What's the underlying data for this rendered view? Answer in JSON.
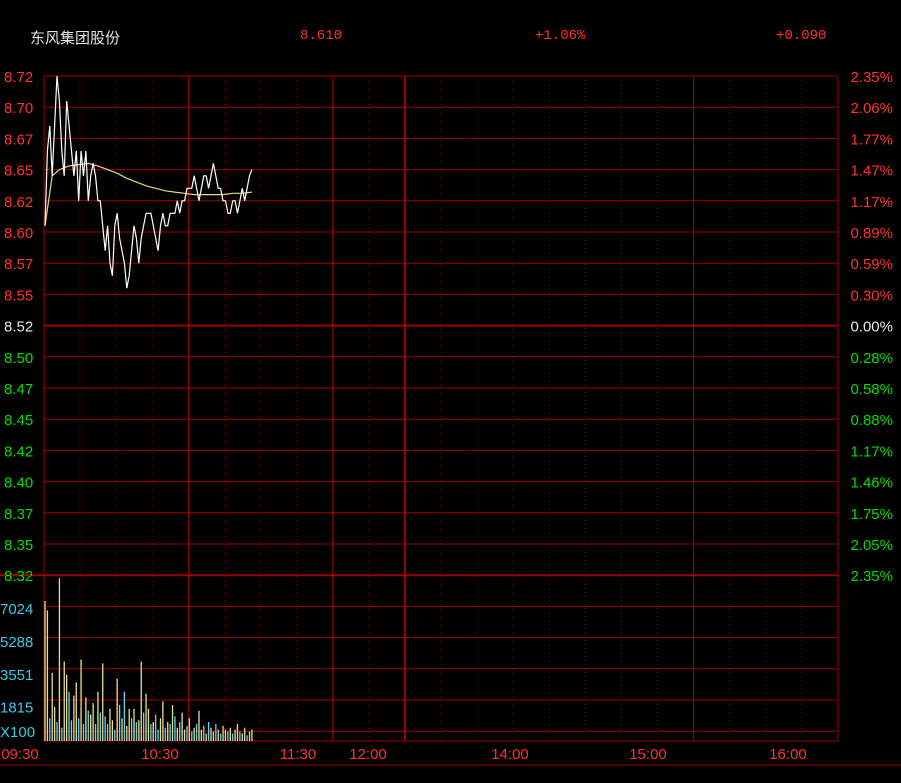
{
  "header": {
    "stock_name": "东风集团股份",
    "price": "8.610",
    "change_pct": "+1.06%",
    "change_abs": "+0.090"
  },
  "colors": {
    "up": "#ff3030",
    "down": "#00dd00",
    "flat": "#e8e8e8",
    "grid": "#a00000",
    "volume_label": "#38c8e8",
    "price_line": "#ffffff",
    "avg_line": "#e8d878",
    "volume_up": "#e8e090",
    "volume_down": "#60d8f0"
  },
  "chart_data": {
    "type": "line",
    "title": "",
    "price_axis": {
      "labels": [
        "8.72",
        "8.70",
        "8.67",
        "8.65",
        "8.62",
        "8.60",
        "8.57",
        "8.55",
        "8.52",
        "8.50",
        "8.47",
        "8.45",
        "8.42",
        "8.40",
        "8.37",
        "8.35",
        "8.32"
      ],
      "ylim": [
        8.32,
        8.72
      ],
      "prev_close": 8.52
    },
    "pct_axis": {
      "labels": [
        "2.35%",
        "2.06%",
        "1.77%",
        "1.47%",
        "1.17%",
        "0.89%",
        "0.59%",
        "0.30%",
        "0.00%",
        "0.28%",
        "0.58%",
        "0.88%",
        "1.17%",
        "1.46%",
        "1.75%",
        "2.05%",
        "2.35%"
      ]
    },
    "volume_axis": {
      "labels": [
        "7024",
        "5288",
        "3551",
        "1815",
        "X100"
      ],
      "ylim": [
        0,
        8760
      ]
    },
    "time_axis": {
      "labels": [
        "09:30",
        "10:30",
        "11:30",
        "12:00",
        "14:00",
        "15:00",
        "16:00"
      ],
      "total_minutes": 330
    },
    "series": [
      {
        "name": "",
        "minutes": [
          0,
          1,
          2,
          3,
          4,
          5,
          6,
          7,
          8,
          9,
          10,
          11,
          12,
          13,
          14,
          15,
          16,
          17,
          18,
          19,
          20,
          21,
          22,
          23,
          24,
          25,
          26,
          27,
          28,
          29,
          30,
          31,
          32,
          33,
          34,
          35,
          36,
          37,
          38,
          39,
          40,
          41,
          42,
          43,
          44,
          45,
          46,
          47,
          48,
          49,
          50,
          51,
          52,
          53,
          54,
          55,
          56,
          57,
          58,
          59,
          60,
          61,
          62,
          63,
          64,
          65,
          66,
          67,
          68,
          69,
          70,
          71,
          72,
          73,
          74,
          75,
          76,
          77,
          78,
          79,
          80,
          81,
          82,
          83,
          84,
          85,
          86
        ],
        "values": [
          8.6,
          8.66,
          8.68,
          8.64,
          8.68,
          8.72,
          8.7,
          8.66,
          8.64,
          8.7,
          8.68,
          8.66,
          8.64,
          8.66,
          8.62,
          8.66,
          8.64,
          8.66,
          8.62,
          8.64,
          8.65,
          8.64,
          8.62,
          8.62,
          8.6,
          8.58,
          8.6,
          8.57,
          8.56,
          8.6,
          8.61,
          8.59,
          8.58,
          8.57,
          8.55,
          8.56,
          8.58,
          8.6,
          8.59,
          8.57,
          8.59,
          8.6,
          8.61,
          8.61,
          8.61,
          8.6,
          8.59,
          8.58,
          8.6,
          8.61,
          8.6,
          8.6,
          8.61,
          8.61,
          8.61,
          8.62,
          8.61,
          8.62,
          8.62,
          8.63,
          8.63,
          8.63,
          8.64,
          8.63,
          8.62,
          8.63,
          8.64,
          8.64,
          8.63,
          8.64,
          8.65,
          8.64,
          8.63,
          8.63,
          8.62,
          8.62,
          8.61,
          8.61,
          8.62,
          8.62,
          8.61,
          8.62,
          8.63,
          8.62,
          8.63,
          8.64,
          8.645
        ]
      },
      {
        "name": "",
        "minutes": [
          0,
          3,
          6,
          10,
          14,
          18,
          22,
          26,
          30,
          34,
          38,
          42,
          46,
          50,
          54,
          58,
          62,
          66,
          70,
          74,
          78,
          82,
          86
        ],
        "values": [
          8.6,
          8.64,
          8.645,
          8.648,
          8.649,
          8.65,
          8.648,
          8.645,
          8.642,
          8.638,
          8.635,
          8.632,
          8.63,
          8.628,
          8.627,
          8.626,
          8.625,
          8.625,
          8.625,
          8.625,
          8.626,
          8.626,
          8.627
        ]
      }
    ],
    "volume": {
      "minutes": [
        0,
        1,
        2,
        3,
        4,
        5,
        6,
        7,
        8,
        9,
        10,
        11,
        12,
        13,
        14,
        15,
        16,
        17,
        18,
        19,
        20,
        21,
        22,
        23,
        24,
        25,
        26,
        27,
        28,
        29,
        30,
        31,
        32,
        33,
        34,
        35,
        36,
        37,
        38,
        39,
        40,
        41,
        42,
        43,
        44,
        45,
        46,
        47,
        48,
        49,
        50,
        51,
        52,
        53,
        54,
        55,
        56,
        57,
        58,
        59,
        60,
        61,
        62,
        63,
        64,
        65,
        66,
        67,
        68,
        69,
        70,
        71,
        72,
        73,
        74,
        75,
        76,
        77,
        78,
        79,
        80,
        81,
        82,
        83,
        84,
        85,
        86
      ],
      "values": [
        7400,
        6900,
        1200,
        3600,
        1800,
        1000,
        8600,
        700,
        4200,
        3500,
        2600,
        1100,
        2400,
        3100,
        1200,
        4300,
        900,
        2300,
        1600,
        1400,
        2000,
        900,
        2600,
        1500,
        4100,
        1300,
        900,
        1700,
        1100,
        600,
        3300,
        1900,
        1200,
        2600,
        800,
        1700,
        1200,
        1700,
        1000,
        1100,
        4200,
        1500,
        2500,
        1700,
        900,
        1000,
        1400,
        600,
        1200,
        2100,
        700,
        1000,
        900,
        1900,
        1300,
        700,
        1000,
        1500,
        600,
        800,
        1200,
        500,
        700,
        900,
        1600,
        600,
        800,
        400,
        1000,
        700,
        500,
        900,
        600,
        400,
        800,
        600,
        500,
        700,
        400,
        600,
        900,
        500,
        400,
        700,
        300,
        500,
        600
      ],
      "up": [
        1,
        1,
        0,
        1,
        1,
        0,
        1,
        0,
        1,
        1,
        0,
        0,
        1,
        1,
        0,
        1,
        0,
        1,
        0,
        1,
        1,
        0,
        1,
        0,
        1,
        0,
        0,
        1,
        1,
        0,
        1,
        0,
        1,
        0,
        1,
        1,
        0,
        1,
        0,
        1,
        1,
        0,
        1,
        1,
        0,
        1,
        0,
        0,
        1,
        1,
        0,
        1,
        0,
        1,
        0,
        1,
        0,
        1,
        1,
        0,
        1,
        0,
        1,
        0,
        1,
        1,
        0,
        1,
        0,
        1,
        1,
        0,
        1,
        0,
        1,
        1,
        0,
        1,
        0,
        1,
        1,
        0,
        1,
        1,
        0,
        1,
        1
      ]
    }
  }
}
